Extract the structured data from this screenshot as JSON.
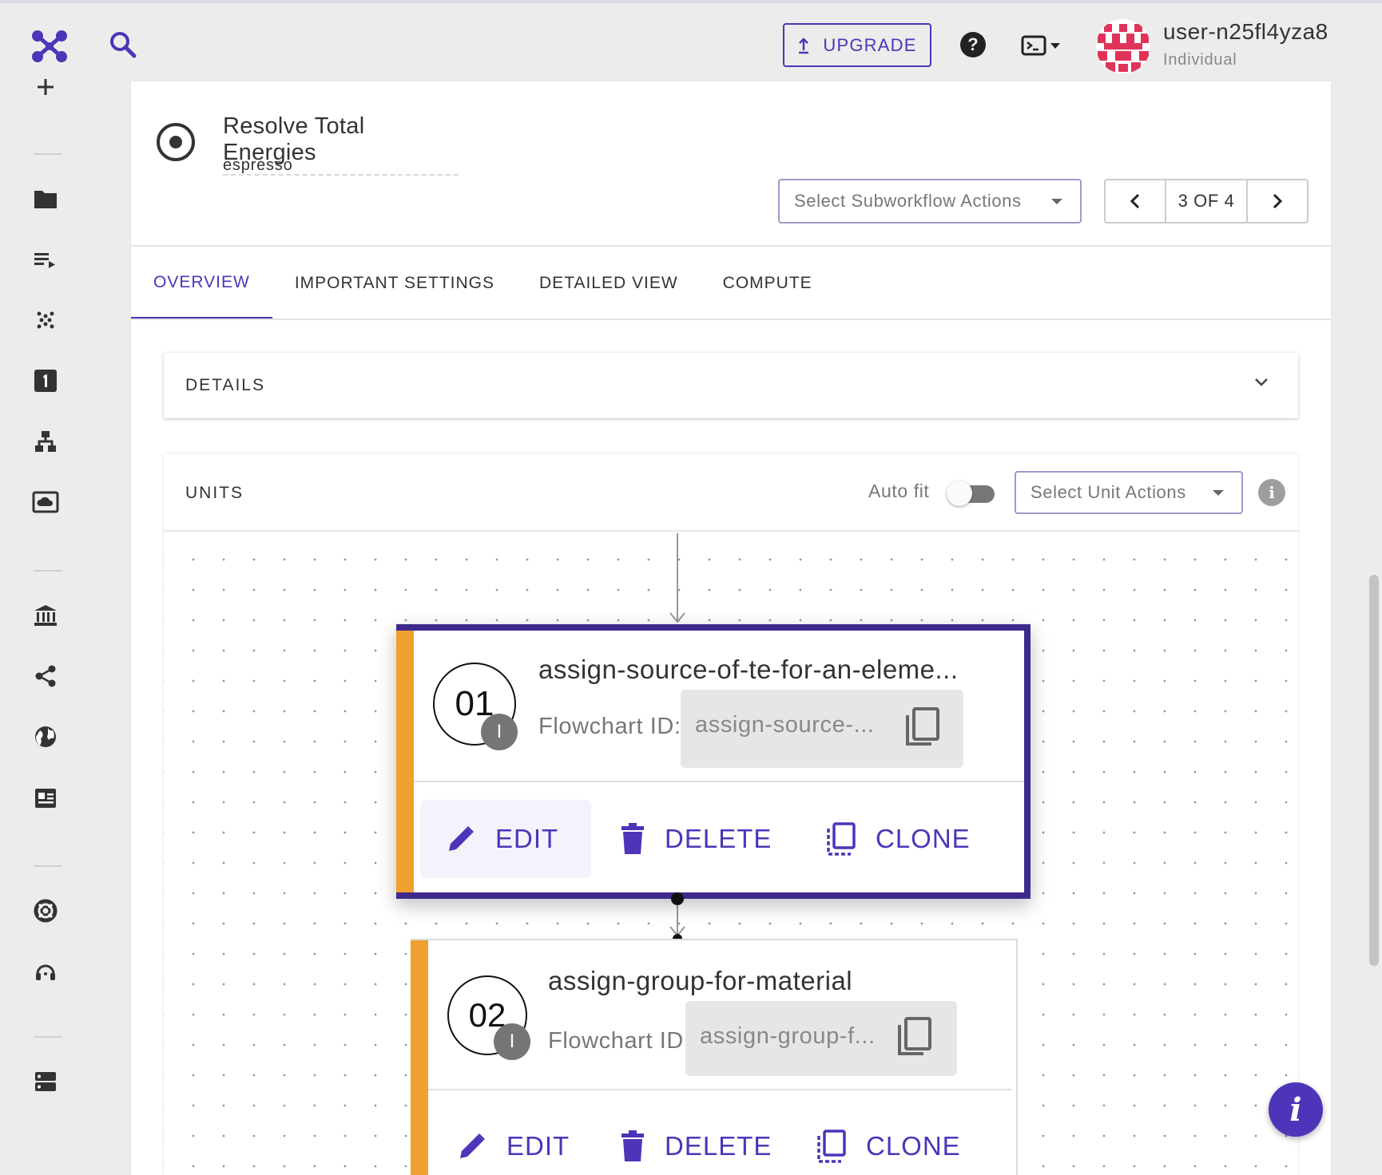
{
  "header": {
    "upgrade_label": "UPGRADE",
    "help_symbol": "?",
    "user_name": "user-n25fl4yza8",
    "user_role": "Individual"
  },
  "sidebar": {
    "items": [
      "plus-icon",
      "folder-icon",
      "playlist-play-icon",
      "dots-grid-icon",
      "numbered-box-icon",
      "hierarchy-icon",
      "cloud-screen-icon",
      "bank-icon",
      "share-icon",
      "globe-icon",
      "badge-icon",
      "lifebuoy-icon",
      "headset-icon",
      "server-icon"
    ]
  },
  "workflow": {
    "title": "Resolve Total Energies",
    "subtitle": "espresso",
    "subworkflow_select_placeholder": "Select Subworkflow Actions",
    "pager_label": "3 OF 4"
  },
  "tabs": [
    {
      "label": "OVERVIEW",
      "active": true
    },
    {
      "label": "IMPORTANT SETTINGS",
      "active": false
    },
    {
      "label": "DETAILED VIEW",
      "active": false
    },
    {
      "label": "COMPUTE",
      "active": false
    }
  ],
  "details": {
    "label": "DETAILS"
  },
  "units": {
    "label": "UNITS",
    "autofit_label": "Auto fit",
    "autofit_on": false,
    "select_placeholder": "Select Unit Actions",
    "info_symbol": "i",
    "items": [
      {
        "index": "01",
        "badge": "I",
        "title": "assign-source-of-te-for-an-eleme...",
        "flowchart_label": "Flowchart ID:",
        "flowchart_value": "assign-source-...",
        "actions": {
          "edit": "EDIT",
          "delete": "DELETE",
          "clone": "CLONE"
        }
      },
      {
        "index": "02",
        "badge": "I",
        "title": "assign-group-for-material",
        "flowchart_label": "Flowchart ID:",
        "flowchart_value": "assign-group-f...",
        "actions": {
          "edit": "EDIT",
          "delete": "DELETE",
          "clone": "CLONE"
        }
      }
    ]
  },
  "fab": {
    "symbol": "i"
  },
  "colors": {
    "accent": "#4e34b8",
    "node_border": "#3f2a8c",
    "stripe": "#f0a030",
    "avatar": "#e0335a"
  }
}
